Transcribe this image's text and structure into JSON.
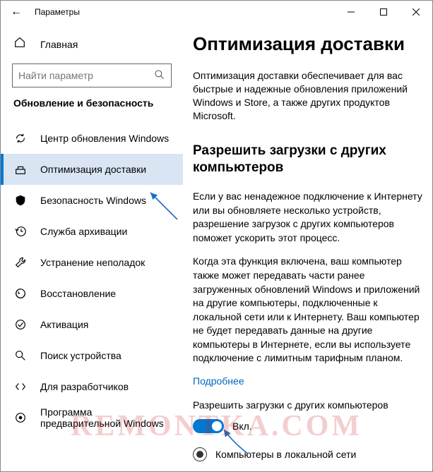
{
  "window": {
    "title": "Параметры"
  },
  "sidebar": {
    "home": "Главная",
    "search_placeholder": "Найти параметр",
    "section": "Обновление и безопасность",
    "items": [
      {
        "label": "Центр обновления Windows"
      },
      {
        "label": "Оптимизация доставки"
      },
      {
        "label": "Безопасность Windows"
      },
      {
        "label": "Служба архивации"
      },
      {
        "label": "Устранение неполадок"
      },
      {
        "label": "Восстановление"
      },
      {
        "label": "Активация"
      },
      {
        "label": "Поиск устройства"
      },
      {
        "label": "Для разработчиков"
      },
      {
        "label": "Программа предварительной Windows"
      }
    ]
  },
  "main": {
    "title": "Оптимизация доставки",
    "intro": "Оптимизация доставки обеспечивает для вас быстрые и надежные обновления приложений Windows и Store, а также других продуктов Microsoft.",
    "subhead": "Разрешить загрузки с других компьютеров",
    "para1": "Если у вас ненадежное подключение к Интернету или вы обновляете несколько устройств, разрешение загрузок с других компьютеров поможет ускорить этот процесс.",
    "para2": "Когда эта функция включена, ваш компьютер также может передавать части ранее загруженных обновлений Windows и приложений на другие компьютеры, подключенные к локальной сети или к Интернету. Ваш компьютер не будет передавать данные на другие компьютеры в Интернете, если вы используете подключение с лимитным тарифным планом.",
    "learn_more": "Подробнее",
    "toggle_caption": "Разрешить загрузки с других компьютеров",
    "toggle_state": "Вкл.",
    "radio1": "Компьютеры в локальной сети"
  },
  "watermark": "REMONTKA.COM"
}
